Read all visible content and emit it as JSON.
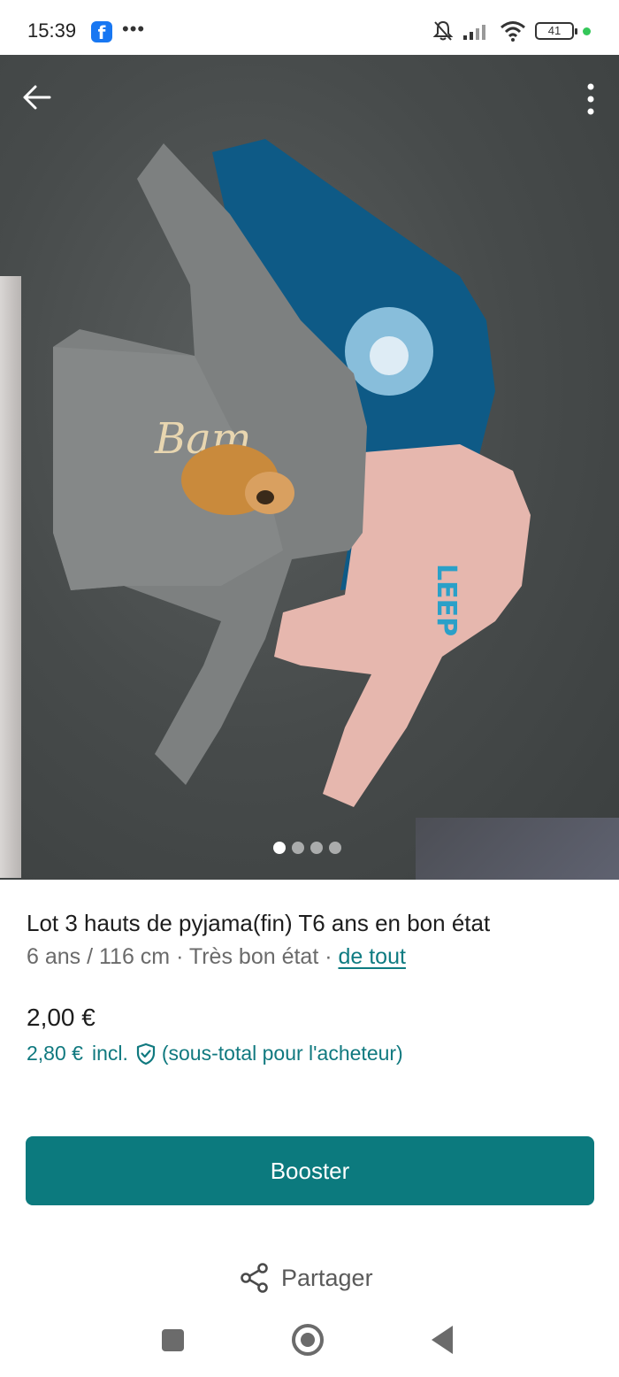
{
  "status_bar": {
    "time": "15:39",
    "app_icon": "facebook-icon",
    "battery": "41"
  },
  "listing": {
    "image_alt": "Photo of three children's pajama tops on a grey blanket",
    "carousel": {
      "total": 4,
      "active": 1
    },
    "title": "Lot 3 hauts de pyjama(fin) T6 ans en bon état",
    "size": "6 ans / 116 cm",
    "separator": " · ",
    "condition": "Très bon état",
    "brand": "de tout",
    "price": "2,00 €",
    "price_incl_amount": "2,80 €",
    "price_incl_label": "incl.",
    "price_incl_note": "(sous-total pour l'acheteur)"
  },
  "actions": {
    "booster_label": "Booster",
    "share_label": "Partager"
  },
  "colors": {
    "accent": "#0c7a7e",
    "link": "#0e7b81",
    "muted_text": "#6a6a6a"
  }
}
